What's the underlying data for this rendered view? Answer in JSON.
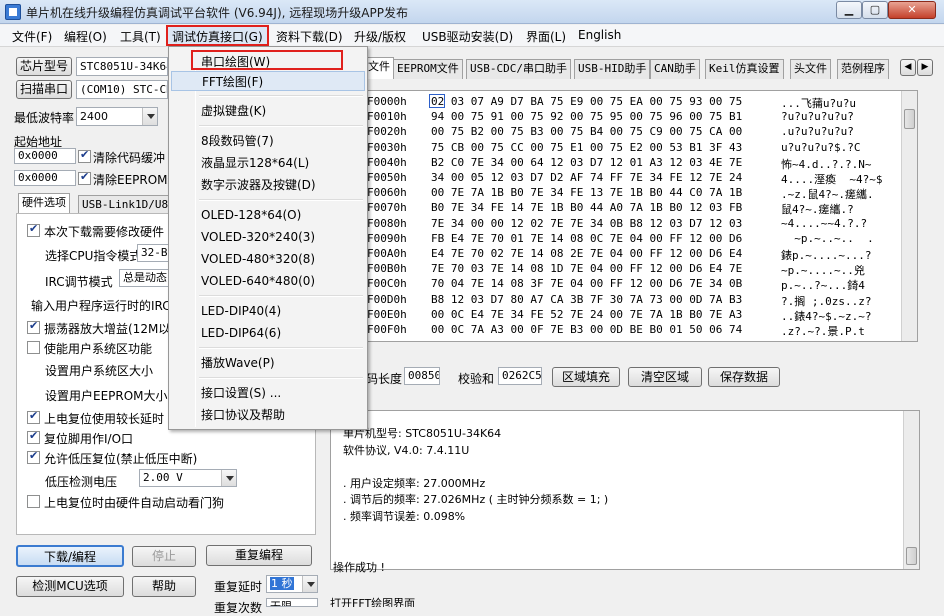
{
  "titlebar": {
    "title": "单片机在线升级编程仿真调试平台软件 (V6.94J), 远程现场升级APP发布",
    "minimize": "▁",
    "maximize": "▢",
    "close": "✕"
  },
  "menubar": {
    "items": [
      "文件(F)",
      "编程(O)",
      "工具(T)",
      "调试仿真接口(G)",
      "资料下载(D)",
      "升级/版权",
      "USB驱动安装(D)",
      "界面(L)",
      "English"
    ]
  },
  "dropdown": {
    "items": [
      "串口绘图(W)",
      "FFT绘图(F)",
      "虚拟键盘(K)",
      "8段数码管(7)",
      "液晶显示128*64(L)",
      "数字示波器及按键(D)",
      "OLED-128*64(O)",
      "VOLED-320*240(3)",
      "VOLED-480*320(8)",
      "VOLED-640*480(0)",
      "LED-DIP40(4)",
      "LED-DIP64(6)",
      "播放Wave(P)",
      "接口设置(S) ...",
      "接口协议及帮助"
    ]
  },
  "left": {
    "chip_model_btn": "芯片型号",
    "chip_model_value": "STC8051U-34K64",
    "scan_port_btn": "扫描串口",
    "port_value": "(COM10) STC-CDC",
    "min_baud_label": "最低波特率",
    "min_baud_value": "2400",
    "start_addr_label": "起始地址",
    "addr1": "0x0000",
    "clear_code_label": "清除代码缓冲",
    "addr2": "0x0000",
    "clear_eeprom_label": "清除EEPROM缓",
    "tabs": [
      "硬件选项",
      "USB-Link1D/U8W"
    ],
    "options": {
      "reset_on_change": "本次下载需要修改硬件",
      "cpu_mode_label": "选择CPU指令模式",
      "cpu_mode_value": "32-B",
      "irc_label": "IRC调节模式",
      "irc_value": "总是动态",
      "irc_input_label": "输入用户程序运行时的IRC",
      "osc_gain": "振荡器放大增益(12M以",
      "user_ram": "使能用户系统区功能",
      "user_ram_size": "设置用户系统区大小",
      "eeprom_size": "设置用户EEPROM大小",
      "power_delay": "上电复位使用较长延时",
      "reset_pin": "复位脚用作I/O口",
      "low_volt": "允许低压复位(禁止低压中断)",
      "low_volt_label": "低压检测电压",
      "low_volt_value": "2.00 V",
      "watchdog": "上电复位时由硬件自动启动看门狗"
    },
    "download_btn": "下载/编程",
    "stop_btn": "停止",
    "reprogram_btn": "重复编程",
    "check_mcu_btn": "检测MCU选项",
    "help_btn": "帮助",
    "repeat_delay_label": "重复延时",
    "repeat_delay_value": "1 秒",
    "repeat_count_label": "重复次数",
    "repeat_count_value": "无限"
  },
  "right": {
    "tabs": [
      "文件",
      "EEPROM文件",
      "USB-CDC/串口助手",
      "USB-HID助手",
      "CAN助手",
      "Keil仿真设置",
      "头文件",
      "范例程序"
    ],
    "hex_rows": [
      {
        "addr": "F0000h",
        "bytes": "02 03 07 A9 D7 BA 75 E9 00 75 EA 00 75 93 00 75",
        "ascii": "...飞蒱u?u?u"
      },
      {
        "addr": "F0010h",
        "bytes": "94 00 75 91 00 75 92 00 75 95 00 75 96 00 75 B1",
        "ascii": "?u?u?u?u?u?"
      },
      {
        "addr": "F0020h",
        "bytes": "00 75 B2 00 75 B3 00 75 B4 00 75 C9 00 75 CA 00",
        "ascii": ".u?u?u?u?u?"
      },
      {
        "addr": "F0030h",
        "bytes": "75 CB 00 75 CC 00 75 E1 00 75 E2 00 53 B1 3F 43",
        "ascii": "u?u?u?u?$.?C"
      },
      {
        "addr": "F0040h",
        "bytes": "B2 C0 7E 34 00 64 12 03 D7 12 01 A3 12 03 4E 7E",
        "ascii": "怖~4.d..?.?.N~"
      },
      {
        "addr": "F0050h",
        "bytes": "34 00 05 12 03 D7 D2 AF 74 FF 7E 34 FE 12 7E 24",
        "ascii": "4....溼瘓  ~4?~$"
      },
      {
        "addr": "F0060h",
        "bytes": "00 7E 7A 1B B0 7E 34 FE 13 7E 1B B0 44 C0 7A 1B",
        "ascii": ".~z.鼠4?~.瘥纗."
      },
      {
        "addr": "F0070h",
        "bytes": "B0 7E 34 FE 14 7E 1B B0 44 A0 7A 1B B0 12 03 FB",
        "ascii": "鼠4?~.瘥纗.?"
      },
      {
        "addr": "F0080h",
        "bytes": "7E 34 00 00 12 02 7E 7E 34 0B B8 12 03 D7 12 03",
        "ascii": "~4....~~4.?.?"
      },
      {
        "addr": "F0090h",
        "bytes": "FB E4 7E 70 01 7E 14 08 0C 7E 04 00 FF 12 00 D6",
        "ascii": "  ~p.~..~..  ."
      },
      {
        "addr": "F00A0h",
        "bytes": "E4 7E 70 02 7E 14 08 2E 7E 04 00 FF 12 00 D6 E4",
        "ascii": "錶p.~....~...?"
      },
      {
        "addr": "F00B0h",
        "bytes": "7E 70 03 7E 14 08 1D 7E 04 00 FF 12 00 D6 E4 7E",
        "ascii": "~p.~....~..兇"
      },
      {
        "addr": "F00C0h",
        "bytes": "70 04 7E 14 08 3F 7E 04 00 FF 12 00 D6 7E 34 0B",
        "ascii": "p.~..?~...錡4"
      },
      {
        "addr": "F00D0h",
        "bytes": "B8 12 03 D7 80 A7 CA 3B 7F 30 7A 73 00 0D 7A B3",
        "ascii": "?.搁 ;.0zs..z?"
      },
      {
        "addr": "F00E0h",
        "bytes": "00 0C E4 7E 34 FE 52 7E 24 00 7E 7A 1B B0 7E A3",
        "ascii": "..錶4?~$.~z.~?"
      },
      {
        "addr": "F00F0h",
        "bytes": "00 0C 7A A3 00 0F 7E B3 00 0D BE B0 01 50 06 74",
        "ascii": ".z?.~?.景.P.t"
      }
    ],
    "code_len_label": "码长度",
    "code_len_value": "00850",
    "checksum_label": "校验和",
    "checksum_value": "0262C5",
    "fill_btn": "区域填充",
    "clear_btn": "清空区域",
    "save_btn": "保存数据",
    "log_lines": [
      "单片机型号: STC8051U-34K64",
      "软件协议, V4.0: 7.4.11U",
      "",
      ". 用户设定频率: 27.000MHz",
      ". 调节后的频率: 27.026MHz ( 主时钟分频系数 = 1; )",
      ". 频率调节误差: 0.098%",
      "",
      "",
      "操作成功 !"
    ],
    "status": "打开FFT绘图界面"
  },
  "colors": {
    "highlight_red": "#e0201c",
    "menu_hover": "#dbe6f4"
  }
}
